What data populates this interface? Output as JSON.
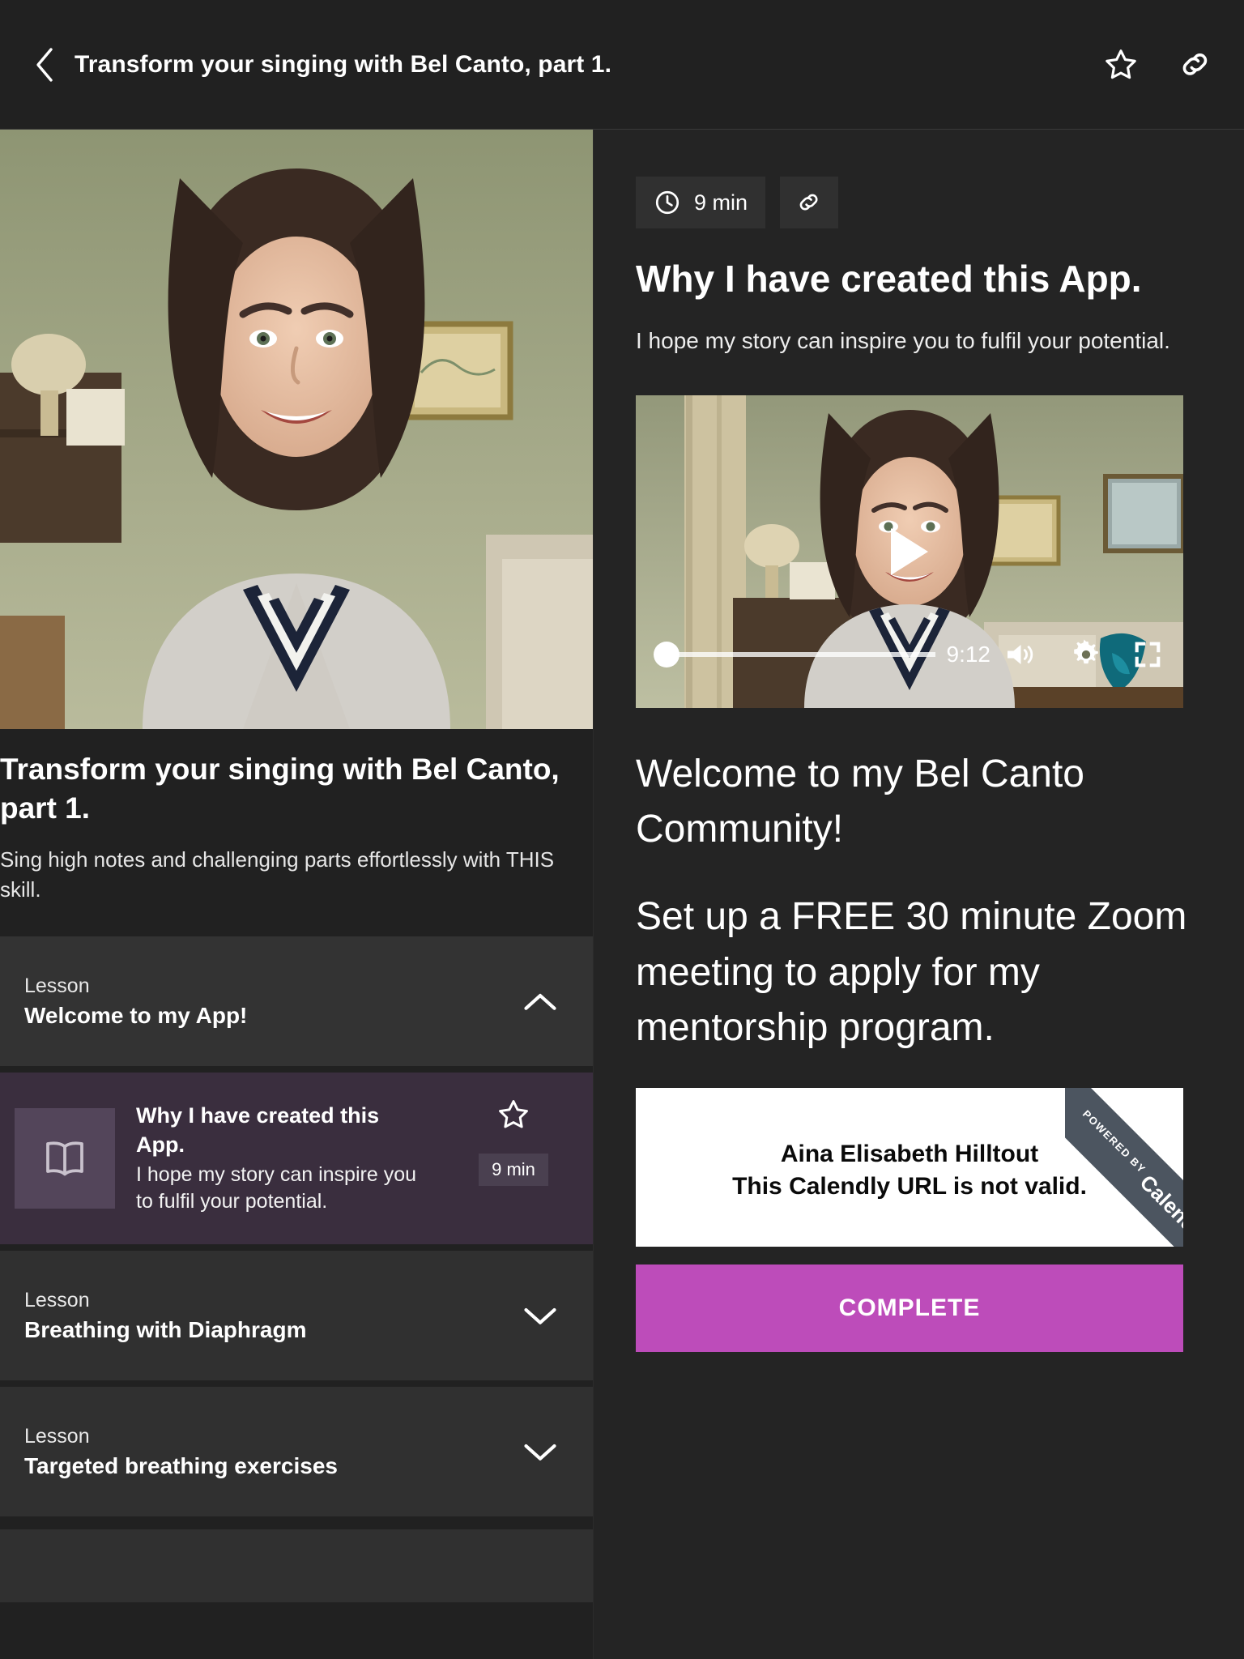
{
  "topbar": {
    "title": "Transform your singing with Bel Canto, part 1.",
    "back_icon": "chevron-left-icon",
    "favorite_icon": "star-outline-icon",
    "share_icon": "link-icon"
  },
  "left": {
    "hero_alt": "Smiling woman with dark wavy hair in grey v-neck sweater in a living room",
    "course_title": "Transform your singing with Bel Canto, part 1.",
    "course_subtitle": "Sing high notes and challenging parts effortlessly with THIS skill.",
    "sections": [
      {
        "kicker": "Lesson",
        "name": "Welcome to my App!",
        "expanded": true,
        "chevron": "chevron-up-icon"
      },
      {
        "kicker": "Lesson",
        "name": "Breathing with Diaphragm",
        "expanded": false,
        "chevron": "chevron-down-icon"
      },
      {
        "kicker": "Lesson",
        "name": "Targeted breathing exercises",
        "expanded": false,
        "chevron": "chevron-down-icon"
      }
    ],
    "active_lesson": {
      "thumb_icon": "open-book-icon",
      "title": "Why I have created this App.",
      "description": "I hope my story can inspire you to fulfil your potential.",
      "favorite_icon": "star-outline-icon",
      "duration_badge": "9 min"
    }
  },
  "right": {
    "duration_chip": {
      "icon": "clock-icon",
      "label": "9 min"
    },
    "share_chip_icon": "link-icon",
    "title": "Why I have created this App.",
    "subtitle": "I hope my story can inspire you to fulfil your potential.",
    "player": {
      "poster_alt": "Smiling woman seated in a living room, video still",
      "play_icon": "play-icon",
      "time": "9:12",
      "volume_icon": "volume-icon",
      "settings_icon": "gear-icon",
      "fullscreen_icon": "fullscreen-icon",
      "progress_percent": 2
    },
    "content_paragraphs": [
      "Welcome to my Bel Canto Community!",
      "Set up a FREE 30 minute Zoom meeting to apply for my mentorship program."
    ],
    "calendly": {
      "owner_name": "Aina Elisabeth Hilltout",
      "error_message": "This Calendly URL is not valid.",
      "ribbon_top": "POWERED BY",
      "ribbon_brand": "Calendly"
    },
    "complete_label": "COMPLETE"
  },
  "colors": {
    "page_bg": "#212121",
    "right_bg": "#242424",
    "card_bg": "#303030",
    "active_lesson_bg": "#3a2e3e",
    "accent": "#bd4cba",
    "ribbon": "#4c5560"
  }
}
